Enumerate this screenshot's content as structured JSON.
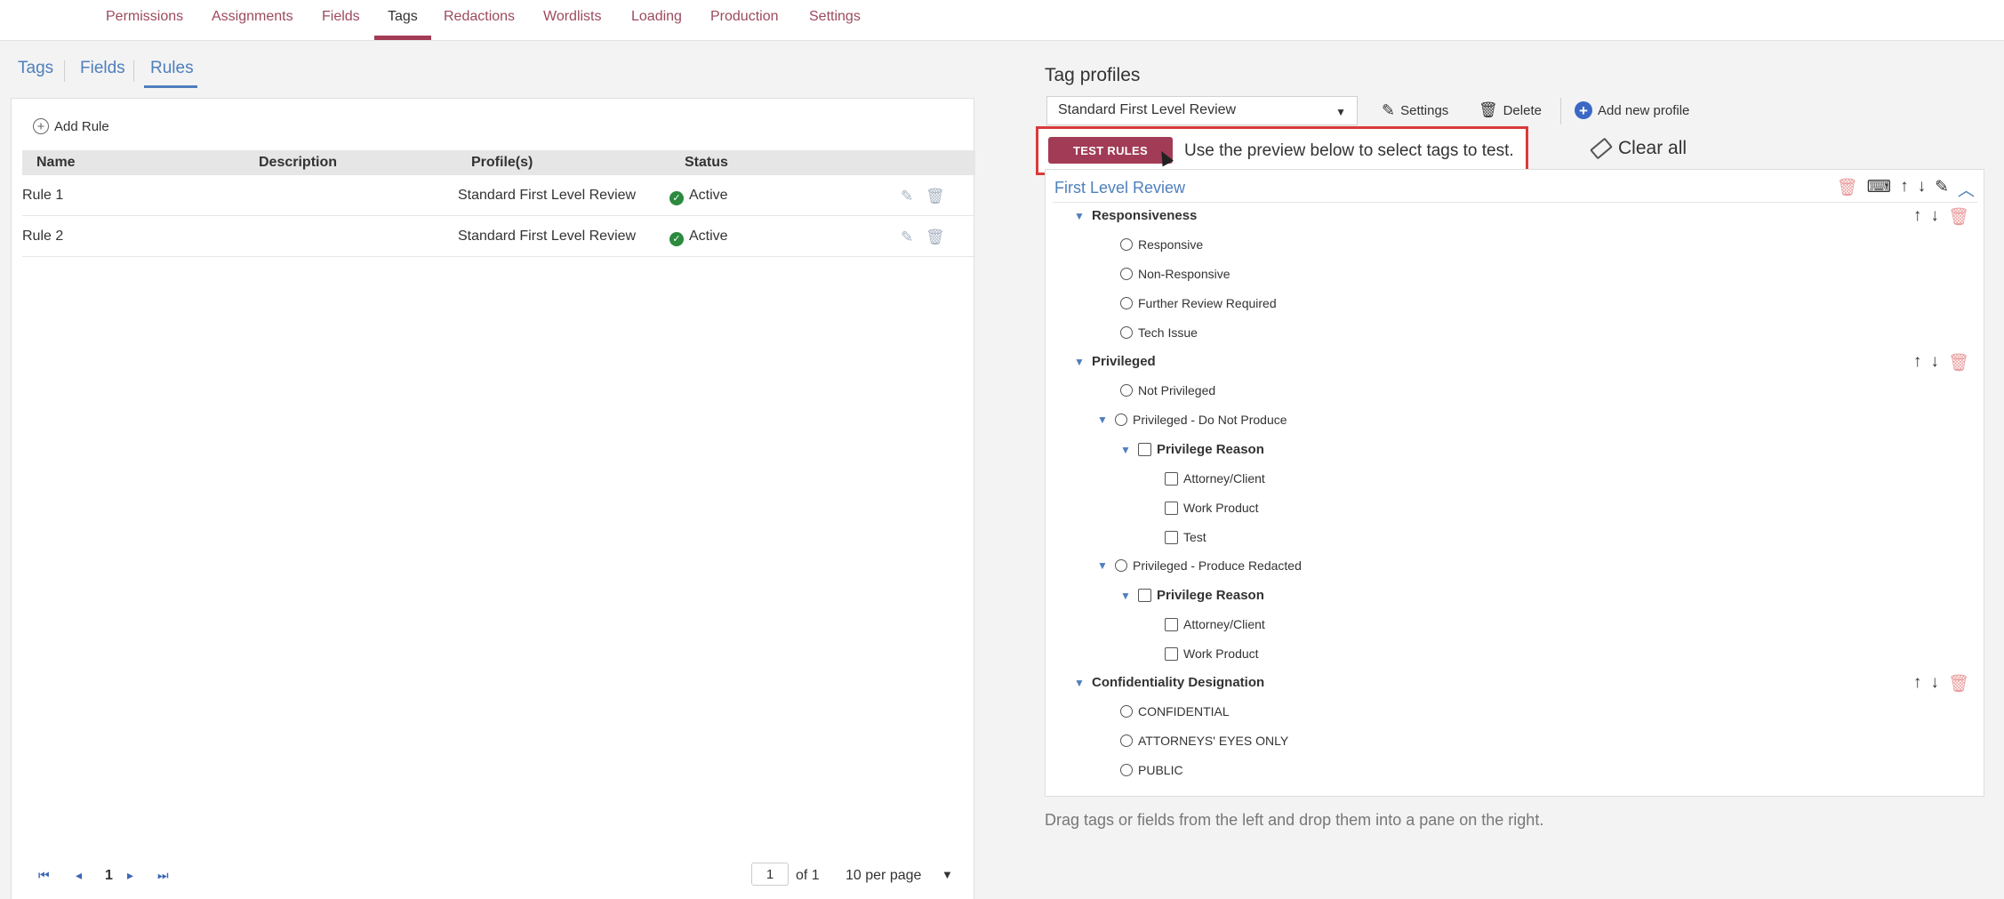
{
  "top_nav": {
    "items": [
      "Permissions",
      "Assignments",
      "Fields",
      "Tags",
      "Redactions",
      "Wordlists",
      "Loading",
      "Production",
      "Settings"
    ],
    "active": "Tags",
    "accent_color": "#a23b55"
  },
  "sub_tabs": {
    "items": [
      "Tags",
      "Fields",
      "Rules"
    ],
    "active": "Rules"
  },
  "rules": {
    "add_label": "Add Rule",
    "columns": [
      "Name",
      "Description",
      "Profile(s)",
      "Status"
    ],
    "rows": [
      {
        "name": "Rule 1",
        "description": "",
        "profile": "Standard First Level Review",
        "status": "Active"
      },
      {
        "name": "Rule 2",
        "description": "",
        "profile": "Standard First Level Review",
        "status": "Active"
      }
    ],
    "pager": {
      "current_page": "1",
      "page_input": "1",
      "of_label": "of 1",
      "per_page": "10 per page"
    }
  },
  "tag_profiles": {
    "title": "Tag profiles",
    "selected_profile": "Standard First Level Review",
    "settings_label": "Settings",
    "delete_label": "Delete",
    "add_profile_label": "Add new profile",
    "test_rules_label": "TEST RULES",
    "test_hint": "Use the preview below to select tags to test.",
    "clear_all_label": "Clear all",
    "pane_title": "First Level Review",
    "groups": {
      "responsiveness": {
        "label": "Responsiveness",
        "options": [
          "Responsive",
          "Non-Responsive",
          "Further Review Required",
          "Tech Issue"
        ]
      },
      "privileged": {
        "label": "Privileged",
        "not_privileged": "Not Privileged",
        "do_not_produce": "Privileged - Do Not Produce",
        "reason_1": {
          "label": "Privilege Reason",
          "options": [
            "Attorney/Client",
            "Work Product",
            "Test"
          ]
        },
        "produce_redacted": "Privileged - Produce Redacted",
        "reason_2": {
          "label": "Privilege Reason",
          "options": [
            "Attorney/Client",
            "Work Product"
          ]
        }
      },
      "confidentiality": {
        "label": "Confidentiality Designation",
        "options": [
          "CONFIDENTIAL",
          "ATTORNEYS' EYES ONLY",
          "PUBLIC"
        ]
      }
    },
    "footer_hint": "Drag tags or fields from the left and drop them into a pane on the right."
  }
}
